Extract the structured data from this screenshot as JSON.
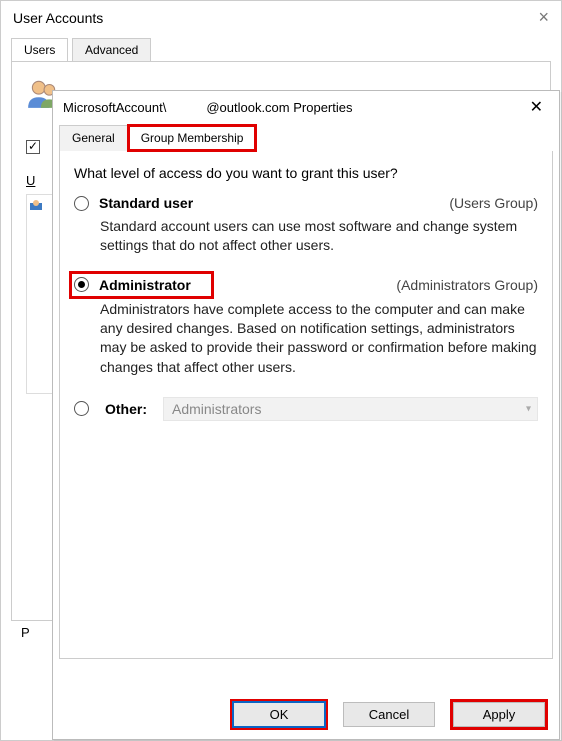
{
  "background": {
    "title": "User Accounts",
    "tabs": [
      "Users",
      "Advanced"
    ],
    "users_header_char": "U",
    "bottom_char": "P"
  },
  "dialog": {
    "title_prefix": "MicrosoftAccount\\",
    "title_suffix": "@outlook.com Properties",
    "tabs": {
      "general": "General",
      "group_membership": "Group Membership"
    },
    "intro": "What level of access do you want to grant this user?",
    "options": {
      "standard": {
        "label": "Standard user",
        "group": "(Users Group)",
        "desc": "Standard account users can use most software and change system settings that do not affect other users."
      },
      "admin": {
        "label": "Administrator",
        "group": "(Administrators Group)",
        "desc": "Administrators have complete access to the computer and can make any desired changes. Based on notification settings, administrators may be asked to provide their password or confirmation before making changes that affect other users."
      },
      "other": {
        "label": "Other:",
        "selected": "Administrators"
      }
    },
    "buttons": {
      "ok": "OK",
      "cancel": "Cancel",
      "apply": "Apply"
    }
  }
}
